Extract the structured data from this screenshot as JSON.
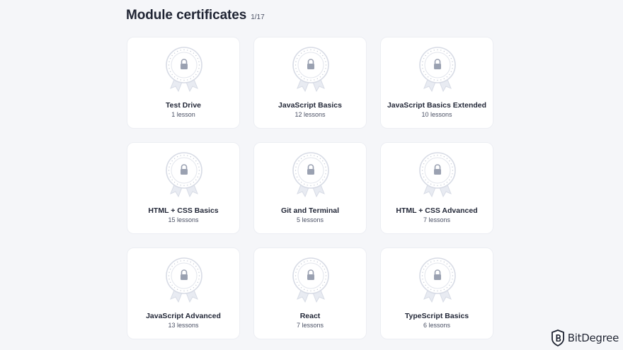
{
  "header": {
    "title": "Module certificates",
    "count": "1/17"
  },
  "badge": {
    "icon": "lock-icon",
    "ring_text": "WILL BE UNLOCKED"
  },
  "cards": [
    {
      "title": "Test Drive",
      "subtitle": "1 lesson"
    },
    {
      "title": "JavaScript Basics",
      "subtitle": "12 lessons"
    },
    {
      "title": "JavaScript Basics Extended",
      "subtitle": "10 lessons"
    },
    {
      "title": "HTML + CSS Basics",
      "subtitle": "15 lessons"
    },
    {
      "title": "Git and Terminal",
      "subtitle": "5 lessons"
    },
    {
      "title": "HTML + CSS Advanced",
      "subtitle": "7 lessons"
    },
    {
      "title": "JavaScript Advanced",
      "subtitle": "13 lessons"
    },
    {
      "title": "React",
      "subtitle": "7 lessons"
    },
    {
      "title": "TypeScript Basics",
      "subtitle": "6 lessons"
    }
  ],
  "watermark": {
    "text": "BitDegree"
  },
  "colors": {
    "background": "#f5f6f9",
    "card": "#ffffff",
    "badge_stroke": "#d7dbe5",
    "text": "#1f2433"
  }
}
